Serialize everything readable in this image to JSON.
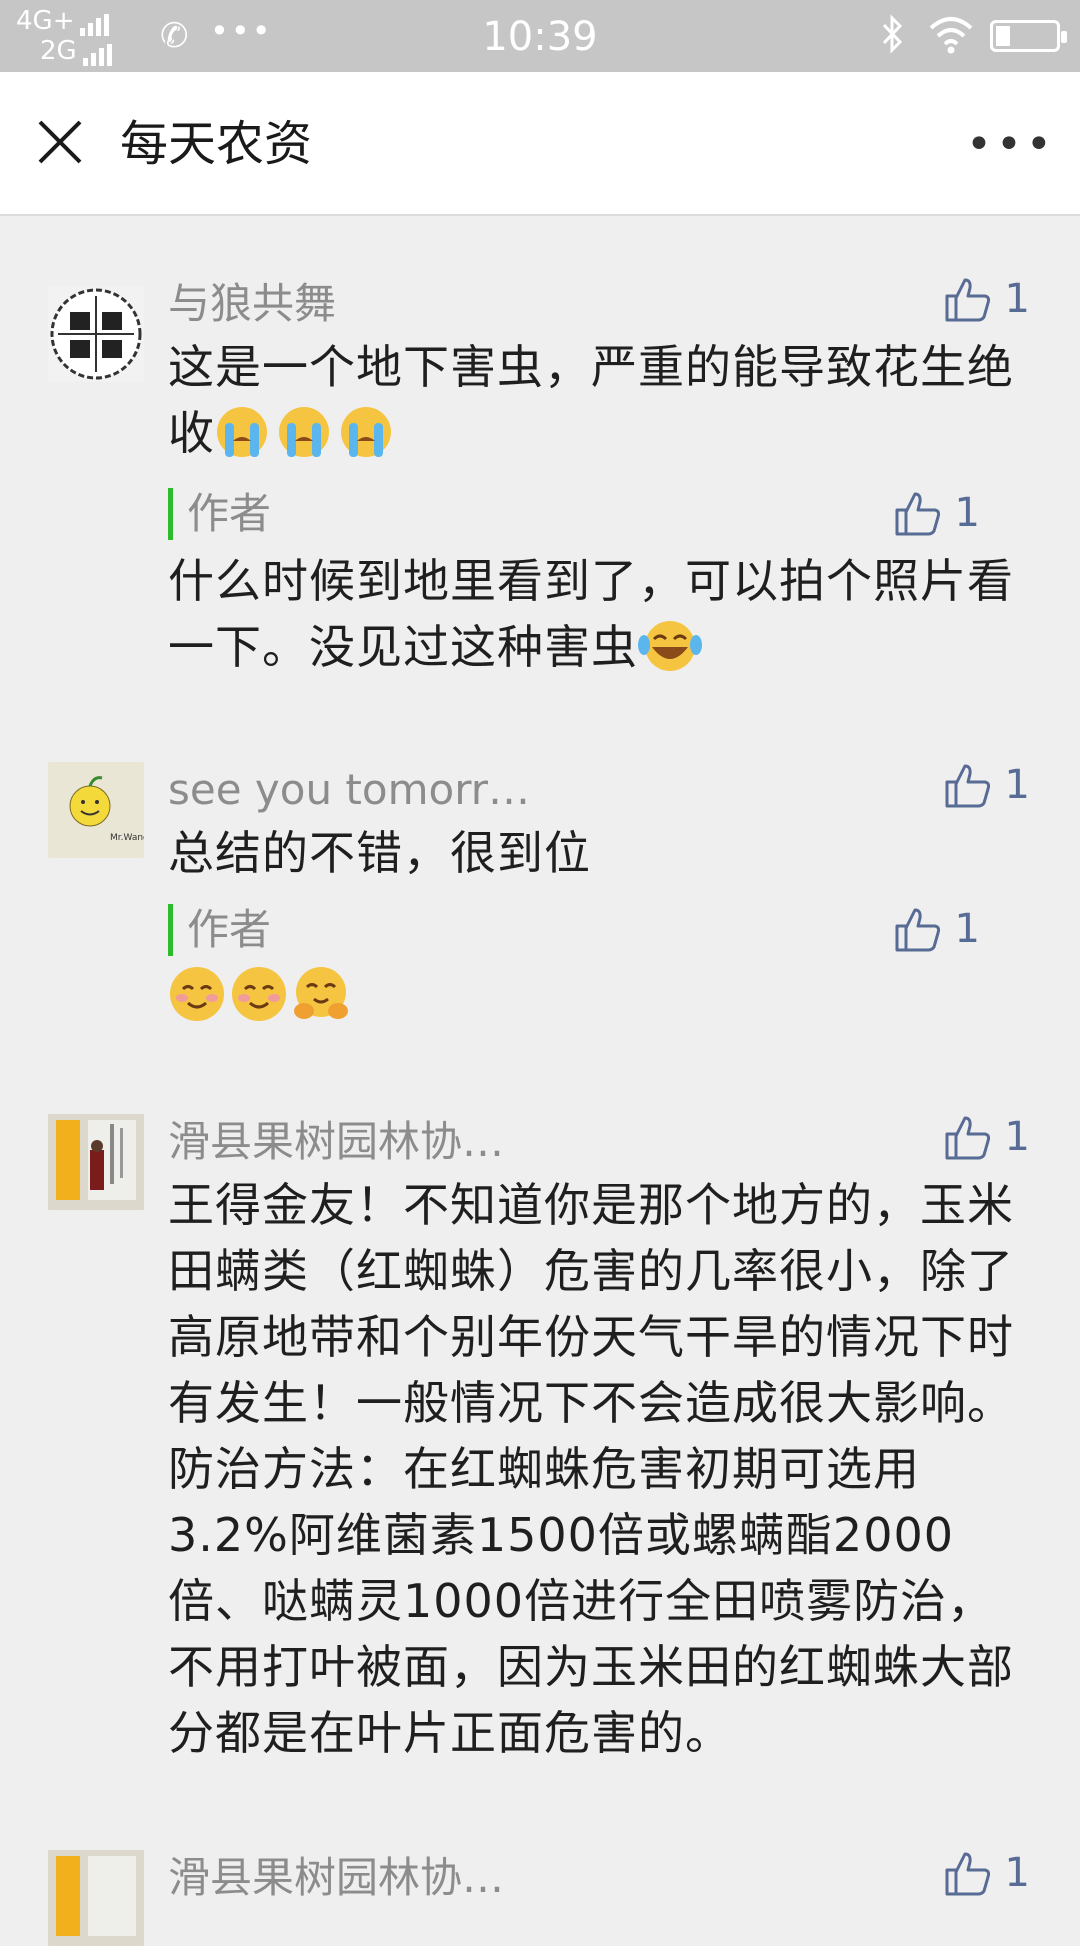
{
  "status_bar": {
    "network_top": "4G+",
    "network_bottom": "2G",
    "time": "10:39",
    "icons": [
      "signal-icon",
      "phone-icon",
      "more-dots-icon",
      "bluetooth-icon",
      "wifi-icon",
      "battery-icon"
    ]
  },
  "nav": {
    "title": "每天农资",
    "close_icon": "close-icon",
    "more_icon": "more-icon"
  },
  "comments": [
    {
      "user": "与狼共舞",
      "text": "这是一个地下害虫，严重的能导致花生绝收",
      "emojis": [
        "crying-emoji",
        "crying-emoji",
        "crying-emoji"
      ],
      "likes": "1",
      "reply": {
        "label": "作者",
        "text": "什么时候到地里看到了，可以拍个照片看一下。没见过这种害虫",
        "emojis": [
          "tears-of-joy-emoji"
        ],
        "likes": "1"
      }
    },
    {
      "user": "see you tomorr…",
      "text": "总结的不错，很到位",
      "likes": "1",
      "reply": {
        "label": "作者",
        "text": "",
        "emojis": [
          "smile-emoji",
          "smile-emoji",
          "hugging-emoji"
        ],
        "likes": "1"
      }
    },
    {
      "user": "滑县果树园林协…",
      "text": "王得金友！不知道你是那个地方的，玉米田螨类（红蜘蛛）危害的几率很小，除了高原地带和个别年份天气干旱的情况下时有发生！一般情况下不会造成很大影响。防治方法：在红蜘蛛危害初期可选用3.2%阿维菌素1500倍或螺螨酯2000倍、哒螨灵1000倍进行全田喷雾防治，不用打叶被面，因为玉米田的红蜘蛛大部分都是在叶片正面危害的。",
      "likes": "1"
    },
    {
      "user": "滑县果树园林协…",
      "likes": "1"
    }
  ],
  "colors": {
    "status_bar_bg": "#c6c6c6",
    "like_blue": "#576b95",
    "author_bar_green": "#2dba2d",
    "username_gray": "#8c8c8c"
  }
}
